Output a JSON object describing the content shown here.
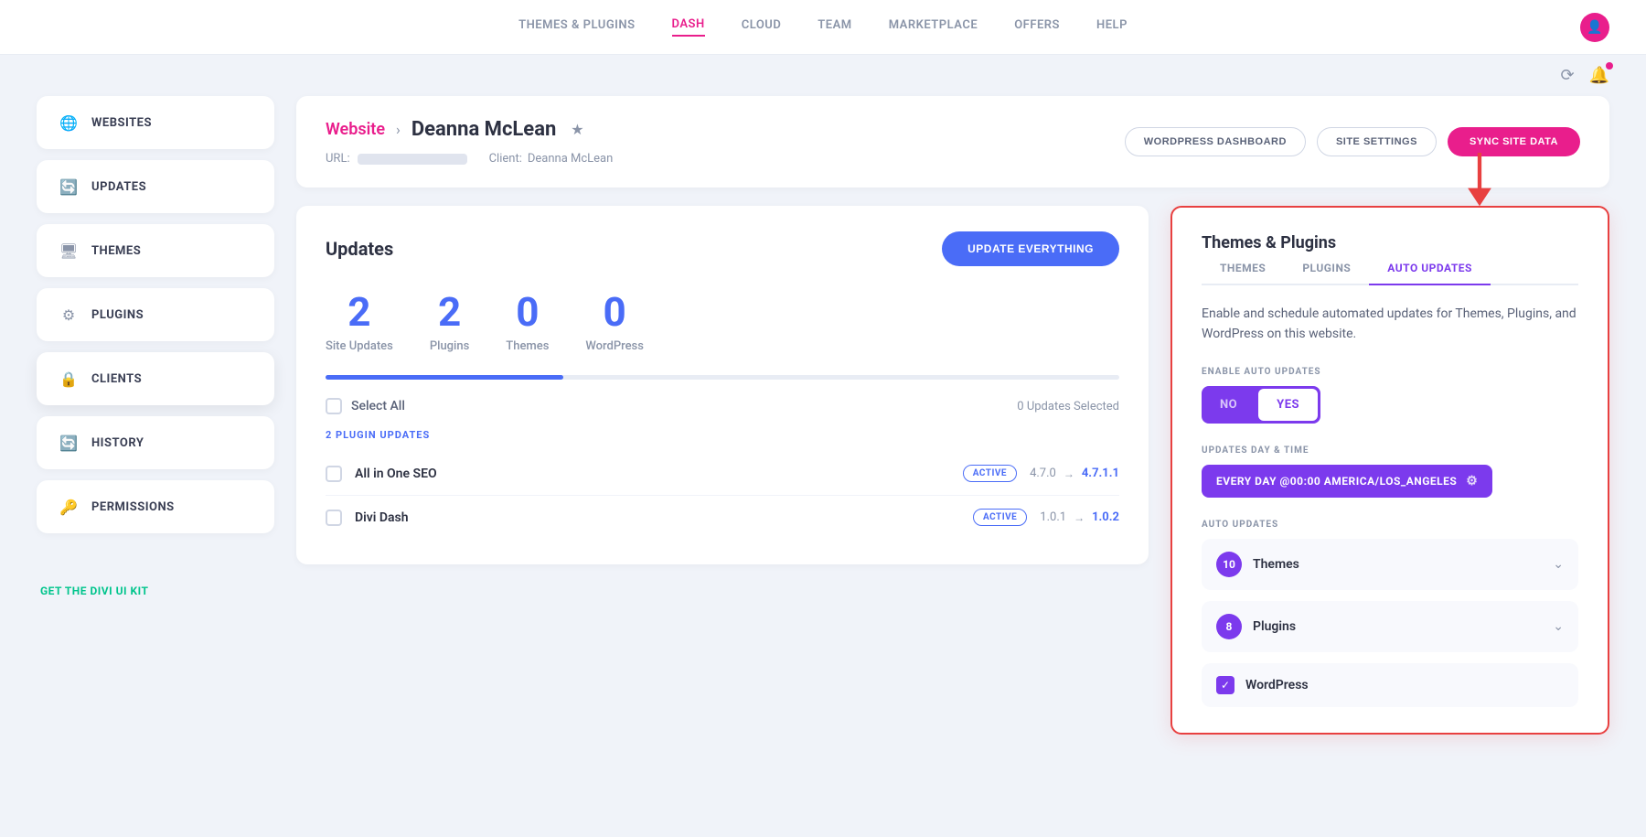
{
  "nav": {
    "links": [
      {
        "id": "themes-plugins",
        "label": "THEMES & PLUGINS",
        "active": false
      },
      {
        "id": "dash",
        "label": "DASH",
        "active": true
      },
      {
        "id": "cloud",
        "label": "CLOUD",
        "active": false
      },
      {
        "id": "team",
        "label": "TEAM",
        "active": false
      },
      {
        "id": "marketplace",
        "label": "MARKETPLACE",
        "active": false
      },
      {
        "id": "offers",
        "label": "OFFERS",
        "active": false
      },
      {
        "id": "help",
        "label": "HELP",
        "active": false
      }
    ]
  },
  "sidebar": {
    "items": [
      {
        "id": "websites",
        "label": "WEBSITES",
        "icon": "🌐"
      },
      {
        "id": "updates",
        "label": "UPDATES",
        "icon": "🔄"
      },
      {
        "id": "themes",
        "label": "THEMES",
        "icon": "🖥"
      },
      {
        "id": "plugins",
        "label": "PLUGINS",
        "icon": "⚙"
      },
      {
        "id": "clients",
        "label": "CLIENTS",
        "icon": "🔒"
      },
      {
        "id": "history",
        "label": "HISTORY",
        "icon": "🔄"
      },
      {
        "id": "permissions",
        "label": "PERMISSIONS",
        "icon": "🔑"
      }
    ],
    "footer_link": "GET THE DIVI UI KIT"
  },
  "site_header": {
    "breadcrumb_website": "Website",
    "arrow": ">",
    "site_name": "Deanna McLean",
    "url_label": "URL:",
    "client_label": "Client:",
    "client_name": "Deanna McLean",
    "btn_wordpress": "WORDPRESS DASHBOARD",
    "btn_settings": "SITE SETTINGS",
    "btn_sync": "SYNC SITE DATA"
  },
  "updates": {
    "title": "Updates",
    "btn_label": "UPDATE EVERYTHING",
    "stats": [
      {
        "number": "2",
        "label": "Site Updates"
      },
      {
        "number": "2",
        "label": "Plugins"
      },
      {
        "number": "0",
        "label": "Themes"
      },
      {
        "number": "0",
        "label": "WordPress"
      }
    ],
    "progress_width": "30%",
    "select_all_label": "Select All",
    "updates_selected": "0 Updates Selected",
    "plugin_updates_label": "2 PLUGIN UPDATES",
    "plugins": [
      {
        "name": "All in One SEO",
        "badge": "ACTIVE",
        "from": "4.7.0",
        "to": "4.7.1.1"
      },
      {
        "name": "Divi Dash",
        "badge": "ACTIVE",
        "from": "1.0.1",
        "to": "1.0.2"
      }
    ]
  },
  "themes_panel": {
    "title": "Themes & Plugins",
    "tabs": [
      {
        "id": "themes",
        "label": "THEMES",
        "active": false
      },
      {
        "id": "plugins",
        "label": "PLUGINS",
        "active": false
      },
      {
        "id": "auto-updates",
        "label": "AUTO UPDATES",
        "active": true
      }
    ],
    "description": "Enable and schedule automated updates for Themes, Plugins, and WordPress on this website.",
    "enable_label": "ENABLE AUTO UPDATES",
    "toggle_no": "NO",
    "toggle_yes": "YES",
    "schedule_label": "UPDATES DAY & TIME",
    "schedule_value": "EVERY DAY @00:00  AMERICA/LOS_ANGELES",
    "auto_updates_label": "AUTO UPDATES",
    "items": [
      {
        "id": "themes-row",
        "count": "10",
        "name": "Themes"
      },
      {
        "id": "plugins-row",
        "count": "8",
        "name": "Plugins"
      }
    ],
    "wordpress_label": "WordPress"
  }
}
